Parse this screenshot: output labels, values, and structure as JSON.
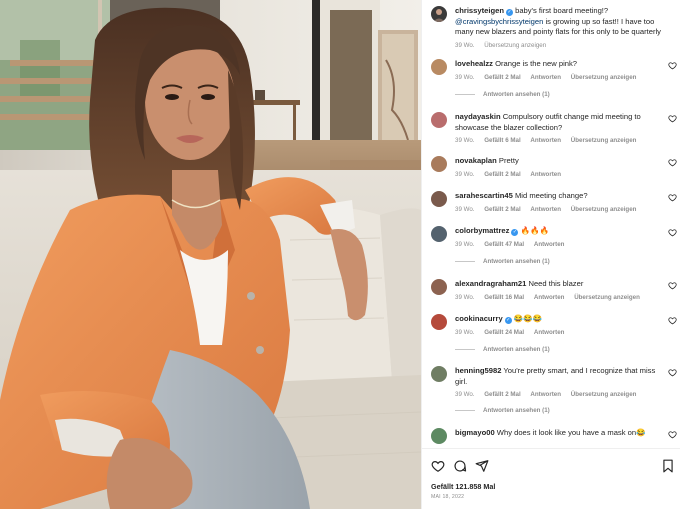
{
  "post": {
    "author": "chrissyteigen",
    "caption_main": "baby's first board meeting!?",
    "caption_mention": "@cravingsbychrissyteigen",
    "caption_rest": "is growing up so fast!! I have too many new blazers and pointy flats for this only to be quarterly",
    "time": "39 Wo.",
    "translate": "Übersetzung anzeigen"
  },
  "comments": [
    {
      "user": "lovehealzz",
      "text": "Orange is the new pink?",
      "time": "39 Wo.",
      "likes": "Gefällt 2 Mal",
      "reply": "Antworten",
      "translate": "Übersetzung anzeigen",
      "view_replies": "Antworten ansehen (1)",
      "avatar_color": "#b88a62"
    },
    {
      "user": "naydayaskin",
      "text": "Compulsory outfit change mid meeting to showcase the blazer collection?",
      "time": "39 Wo.",
      "likes": "Gefällt 6 Mal",
      "reply": "Antworten",
      "translate": "Übersetzung anzeigen",
      "avatar_color": "#b96d6d"
    },
    {
      "user": "novakaplan",
      "text": "Pretty",
      "time": "39 Wo.",
      "likes": "Gefällt 2 Mal",
      "reply": "Antworten",
      "avatar_color": "#a97b5c"
    },
    {
      "user": "sarahescartin45",
      "text": "Mid meeting change?",
      "time": "39 Wo.",
      "likes": "Gefällt 2 Mal",
      "reply": "Antworten",
      "translate": "Übersetzung anzeigen",
      "avatar_color": "#7a5a4c"
    },
    {
      "user": "colorbymattrez",
      "text": "🔥🔥🔥",
      "time": "39 Wo.",
      "likes": "Gefällt 47 Mal",
      "reply": "Antworten",
      "view_replies": "Antworten ansehen (1)",
      "avatar_color": "#54626e"
    },
    {
      "user": "alexandragraham21",
      "text": "Need this blazer",
      "time": "39 Wo.",
      "likes": "Gefällt 16 Mal",
      "reply": "Antworten",
      "translate": "Übersetzung anzeigen",
      "avatar_color": "#8c6250"
    },
    {
      "user": "cookinacurry",
      "text": "😂😂😂",
      "time": "39 Wo.",
      "likes": "Gefällt 24 Mal",
      "reply": "Antworten",
      "view_replies": "Antworten ansehen (1)",
      "avatar_color": "#b54a3b"
    },
    {
      "user": "henning5982",
      "text": "You're pretty smart, and I recognize that miss girl.",
      "time": "39 Wo.",
      "likes": "Gefällt 2 Mal",
      "reply": "Antworten",
      "translate": "Übersetzung anzeigen",
      "view_replies": "Antworten ansehen (1)",
      "avatar_color": "#6f7d63"
    },
    {
      "user": "bigmayo00",
      "text": "Why does it look like you have a mask on😂",
      "time": "39 Wo.",
      "avatar_color": "#5d8a62"
    }
  ],
  "footer": {
    "likes": "Gefällt 121.858 Mal",
    "date": "MAI 18, 2022"
  },
  "colors": {
    "link": "#00376b",
    "verified": "#3897f0",
    "muted": "#8e8e8e",
    "blazer": "#e4894f"
  }
}
